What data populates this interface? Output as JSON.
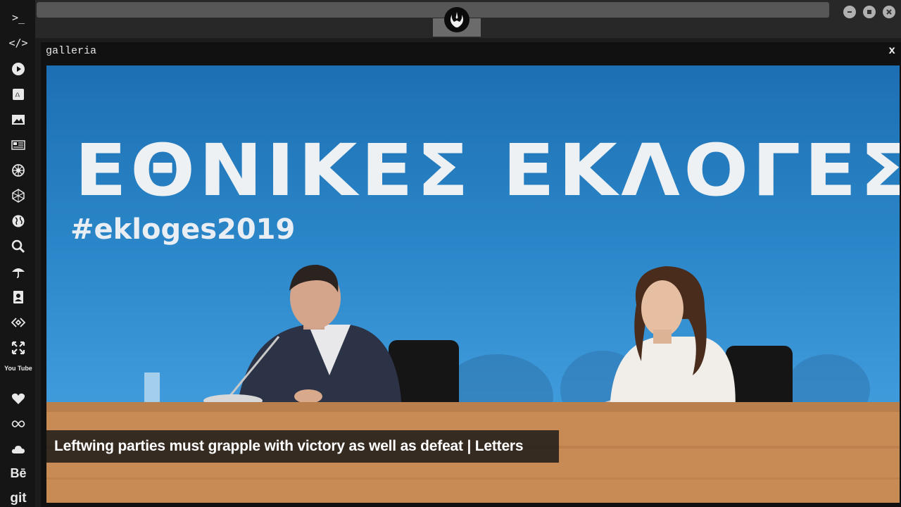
{
  "window": {
    "title": "galleria",
    "close_label": "x"
  },
  "sidebar": {
    "items": [
      {
        "name": "terminal-icon",
        "label": ">_"
      },
      {
        "name": "code-icon",
        "label": "</>"
      },
      {
        "name": "play-icon"
      },
      {
        "name": "translate-icon"
      },
      {
        "name": "image-icon"
      },
      {
        "name": "news-icon"
      },
      {
        "name": "rebel-icon"
      },
      {
        "name": "empire-icon"
      },
      {
        "name": "globe-icon"
      },
      {
        "name": "search-icon"
      },
      {
        "name": "umbrella-icon"
      },
      {
        "name": "contacts-icon"
      },
      {
        "name": "embed-icon"
      },
      {
        "name": "expand-icon"
      },
      {
        "name": "youtube-icon",
        "label": "You Tube"
      },
      {
        "name": "heart-icon"
      },
      {
        "name": "infinity-icon"
      },
      {
        "name": "cloud-icon"
      },
      {
        "name": "behance-icon",
        "label": "Bē"
      },
      {
        "name": "git-icon",
        "label": "git"
      }
    ]
  },
  "photo": {
    "heading": "ΕΘΝΙΚΕΣ ΕΚΛΟΓΕΣ",
    "hashtag": "#ekloges2019",
    "caption": "Leftwing parties must grapple with victory as well as defeat | Letters"
  }
}
